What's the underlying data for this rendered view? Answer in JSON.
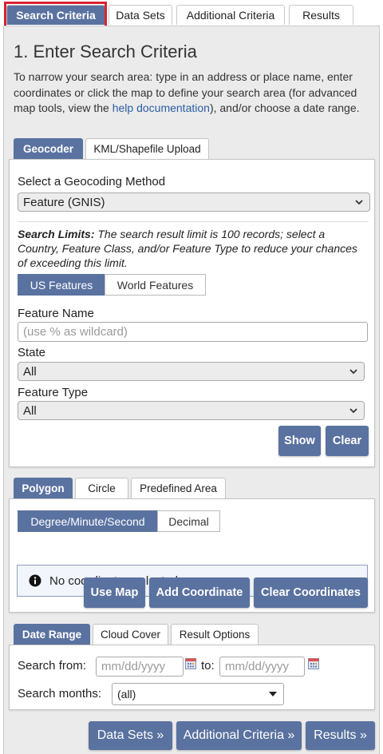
{
  "top_tabs": [
    {
      "label": "Search Criteria",
      "active": true
    },
    {
      "label": "Data Sets",
      "active": false
    },
    {
      "label": "Additional Criteria",
      "active": false
    },
    {
      "label": "Results",
      "active": false
    }
  ],
  "title": "1. Enter Search Criteria",
  "intro": {
    "before_link": "To narrow your search area: type in an address or place name, enter coordinates or click the map to define your search area (for advanced map tools, view the ",
    "link": "help documentation",
    "after_link": "), and/or choose a date range."
  },
  "geo_tabs": [
    {
      "label": "Geocoder",
      "active": true
    },
    {
      "label": "KML/Shapefile Upload",
      "active": false
    }
  ],
  "geocoder": {
    "method_label": "Select a Geocoding Method",
    "method_value": "Feature (GNIS)",
    "limits_bold": "Search Limits:",
    "limits_text": " The search result limit is 100 records; select a Country, Feature Class, and/or Feature Type to reduce your chances of exceeding this limit.",
    "region_toggle": [
      {
        "label": "US Features",
        "active": true
      },
      {
        "label": "World Features",
        "active": false
      }
    ],
    "feature_name_label": "Feature Name",
    "feature_name_placeholder": "(use % as wildcard)",
    "state_label": "State",
    "state_value": "All",
    "feature_type_label": "Feature Type",
    "feature_type_value": "All",
    "show_button": "Show",
    "clear_button": "Clear"
  },
  "area_tabs": [
    {
      "label": "Polygon",
      "active": true
    },
    {
      "label": "Circle",
      "active": false
    },
    {
      "label": "Predefined Area",
      "active": false
    }
  ],
  "polygon": {
    "format_toggle": [
      {
        "label": "Degree/Minute/Second",
        "active": true
      },
      {
        "label": "Decimal",
        "active": false
      }
    ],
    "notice": "No coordinates selected.",
    "use_map_button": "Use Map",
    "add_coordinate_button": "Add Coordinate",
    "clear_coordinates_button": "Clear Coordinates"
  },
  "date_tabs": [
    {
      "label": "Date Range",
      "active": true
    },
    {
      "label": "Cloud Cover",
      "active": false
    },
    {
      "label": "Result Options",
      "active": false
    }
  ],
  "date_range": {
    "from_label": "Search from:",
    "from_placeholder": "mm/dd/yyyy",
    "to_label": "to:",
    "to_placeholder": "mm/dd/yyyy",
    "months_label": "Search months:",
    "months_value": "(all)"
  },
  "footer_buttons": {
    "data_sets": "Data Sets »",
    "additional_criteria": "Additional Criteria »",
    "results": "Results »"
  },
  "colors": {
    "accent": "#5a72a0",
    "highlight": "#d9232e",
    "link": "#2a5ea4"
  }
}
